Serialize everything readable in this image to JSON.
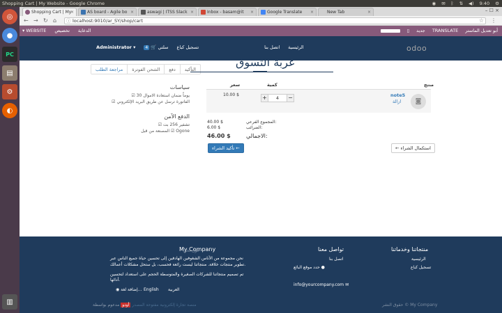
{
  "os": {
    "window_title": "Shopping Cart | My Website - Google Chrome",
    "clock": "9:40",
    "tray_icons": [
      "chrome-icon",
      "mail-icon",
      "bluetooth-icon",
      "sort-icon",
      "wifi-icon",
      "volume-icon"
    ]
  },
  "launcher": {
    "apps": [
      "ubuntu-dash-icon",
      "chrome-icon",
      "pycharm-icon",
      "files-icon",
      "settings-icon",
      "firefox-icon",
      "trash-icon"
    ]
  },
  "browser": {
    "tabs": [
      {
        "label": "Shopping Cart | My",
        "active": true,
        "color": "#875a7b"
      },
      {
        "label": "AS board - Agile bo",
        "active": false,
        "color": "#3b73af"
      },
      {
        "label": "aswagi | ITSS Slack",
        "active": false,
        "color": "#555555"
      },
      {
        "label": "Inbox - basam@it",
        "active": false,
        "color": "#d14836"
      },
      {
        "label": "Google Translate",
        "active": false,
        "color": "#4285f4"
      },
      {
        "label": "New Tab",
        "active": false,
        "color": ""
      }
    ],
    "url": "localhost:9010/ar_SY/shop/cart"
  },
  "editbar": {
    "website_label": "▾ WEBSITE",
    "customize_label": "تخصيص",
    "promote_label": "الدعاية",
    "new_label": "جديد",
    "translate_label": "TRANSLATE",
    "user_label": "أبو تعديل الماستر"
  },
  "sitenav": {
    "logo": "odoo",
    "home": "الرئيسية",
    "contact": "اتصل بنا",
    "cart_label": "سلتي",
    "cart_count": "4",
    "logout": "تسجيل كباع",
    "admin": "Administrator ▾"
  },
  "wizard": {
    "steps": [
      "مراجعة الطلب",
      "الشحن الفوترة",
      "دفع",
      "التأكيد"
    ]
  },
  "page": {
    "title": "عربة التسوق"
  },
  "policies": {
    "heading": "سياسات",
    "line1": "☑ 30 يوماً ضمان استعادة الاموال",
    "line2": "☑ الفاتورة ترسل عن طريق البريد الإلكتروني"
  },
  "secure": {
    "heading": "الدفع الآمن",
    "line1": "☑ تشفير 256 بت",
    "line2": "المصنعة من قبل ☑ Ogone"
  },
  "cart": {
    "col_product": "منتج",
    "col_qty": "كمية",
    "col_price": "سعر",
    "product_name": "note5",
    "remove_label": "ازالة",
    "qty": "4",
    "unit_price": "10.00 $"
  },
  "totals": {
    "subtotal_label": "المجموع الفرعي:",
    "subtotal_value": "40.00 $",
    "taxes_label": "الضرائب:",
    "taxes_value": "6.00 $",
    "total_label": "الاجمالي:",
    "total_value": "46.00 $"
  },
  "actions": {
    "checkout": "تأكيد الشراء ←",
    "continue": "← استكمال الشراء"
  },
  "footer": {
    "products_heading": "منتجاتنا وخدماتنا",
    "products_home": "الرئيسية",
    "products_register": "تسجيل كباع",
    "contact_heading": "تواصل معنا",
    "contact_us": "اتصل بنا",
    "contact_phone": "حدد موقع البائع",
    "contact_email": "info@yourcompany.com",
    "company_heading": "My Company",
    "company_about": "حول نحن",
    "company_text1": "نحن مجموعة من الأناس الشغوفين الهادفين إلى تحسين حياة جميع الناس عبر",
    "company_text2": "تطوير منتجات خلاقة. منتجاتنا ليست رائعة فحسب، بل ستحل مشكلات أعمالك.",
    "company_text3": "تم تصميم منتجاتنا للشركات الصغيرة والمتوسطة الحجم على استعداد لتحسين",
    "company_text4": "أدائها.",
    "lang_arabic": "العربية",
    "lang_english": "English",
    "lang_add": "إضافة لغة...",
    "copyright": "حقوق النشر © My Company",
    "powered": "مدعوم بواسطة",
    "powered_badge": "أودو",
    "powered_tail": "منصة تجارة إلكترونية مفتوحة المصدر"
  }
}
